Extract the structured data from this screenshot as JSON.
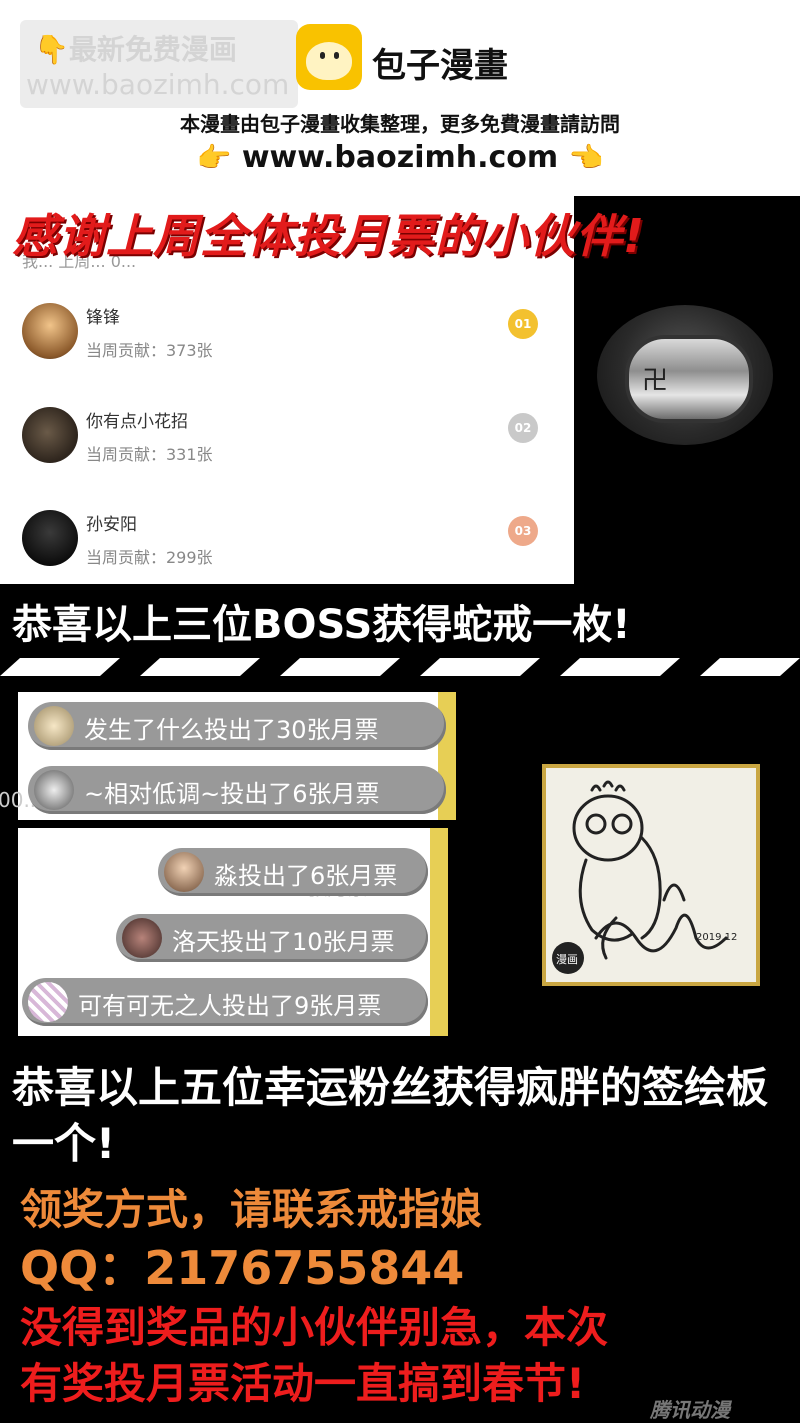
{
  "header": {
    "watermark_line1": "最新免费漫画",
    "watermark_line2": "www.baozimh.com",
    "brand_name": "包子漫畫",
    "notice": "本漫畫由包子漫畫收集整理，更多免費漫畫請訪問",
    "url": "www.baozimh.com",
    "pointing_hand": "👉",
    "pointing_hand_left": "👈",
    "watermark_hand": "👇"
  },
  "ranking": {
    "banner": "感谢上周全体投月票的小伙伴!",
    "faded_header": "我... 上周... 0...",
    "rows": [
      {
        "name": "锋锋",
        "contribution": "当周贡献：373张",
        "medal": "01",
        "medal_color": "#f3c12f"
      },
      {
        "name": "你有点小花招",
        "contribution": "当周贡献：331张",
        "medal": "02",
        "medal_color": "#c9c9c9"
      },
      {
        "name": "孙安阳",
        "contribution": "当周贡献：299张",
        "medal": "03",
        "medal_color": "#eea98a"
      }
    ],
    "congrats": "恭喜以上三位BOSS获得蛇戒一枚!"
  },
  "fans": {
    "group_a": [
      {
        "text": "发生了什么投出了30张月票"
      },
      {
        "text": "~相对低调~投出了6张月票"
      }
    ],
    "group_b": [
      {
        "text": "淼投出了6张月票"
      },
      {
        "text": "洛天投出了10张月票"
      },
      {
        "text": "可有可无之人投出了9张月票"
      }
    ],
    "faded_a": "00...",
    "faded_b": "33张月票",
    "board_date": "2019.12",
    "board_stamp": "漫画",
    "congrats": "恭喜以上五位幸运粉丝获得疯胖的签绘板一个!",
    "claim_method": "领奖方式，请联系戒指娘",
    "qq": "QQ：2176755844",
    "apology_line1": "没得到奖品的小伙伴别急，本次",
    "apology_line2": "有奖投月票活动一直搞到春节!",
    "corner_logo": "腾讯动漫"
  }
}
